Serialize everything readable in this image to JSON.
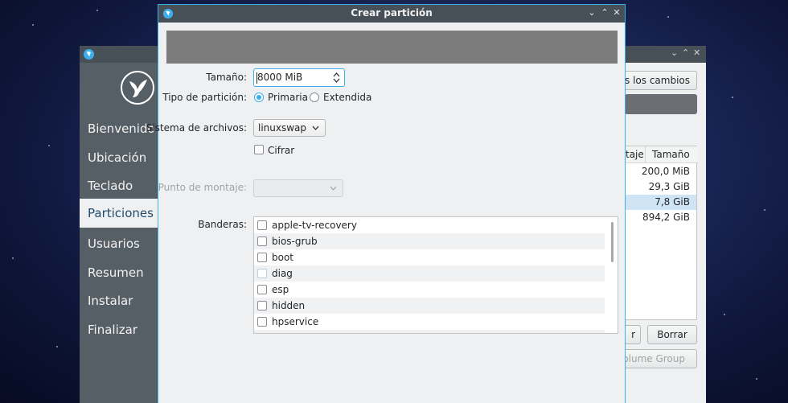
{
  "background_window": {
    "sidebar": {
      "items": [
        {
          "label": "Bienvenido",
          "active": false
        },
        {
          "label": "Ubicación",
          "active": false
        },
        {
          "label": "Teclado",
          "active": false
        },
        {
          "label": "Particiones",
          "active": true
        },
        {
          "label": "Usuarios",
          "active": false
        },
        {
          "label": "Resumen",
          "active": false
        },
        {
          "label": "Instalar",
          "active": false
        },
        {
          "label": "Finalizar",
          "active": false
        }
      ]
    },
    "revert_button_label": "odos los cambios",
    "table": {
      "col_partial_label": "taje",
      "col_size_label": "Tamaño",
      "sizes": [
        "200,0 MiB",
        "29,3 GiB",
        "7,8 GiB",
        "894,2 GiB"
      ],
      "selected_index": 2
    },
    "edit_button_label": "r",
    "delete_button_label": "Borrar",
    "volume_group_button_label": "Volume Group"
  },
  "dialog": {
    "title": "Crear partición",
    "size": {
      "label": "Tamaño:",
      "value": "8000 MiB"
    },
    "partition_type": {
      "label": "Tipo de partición:",
      "options": [
        {
          "label": "Primaria",
          "checked": true
        },
        {
          "label": "Extendida",
          "checked": false
        }
      ]
    },
    "filesystem": {
      "label": "Sistema de archivos:",
      "value": "linuxswap"
    },
    "encrypt": {
      "label": "Cifrar",
      "checked": false
    },
    "mount_point": {
      "label": "Punto de montaje:",
      "value": ""
    },
    "flags": {
      "label": "Banderas:",
      "items": [
        "apple-tv-recovery",
        "bios-grub",
        "boot",
        "diag",
        "esp",
        "hidden",
        "hpservice"
      ]
    }
  },
  "colors": {
    "accent": "#3daee9",
    "titlebar": "#475057",
    "sidebar": "#575f66",
    "window_bg": "#eff0f1"
  }
}
